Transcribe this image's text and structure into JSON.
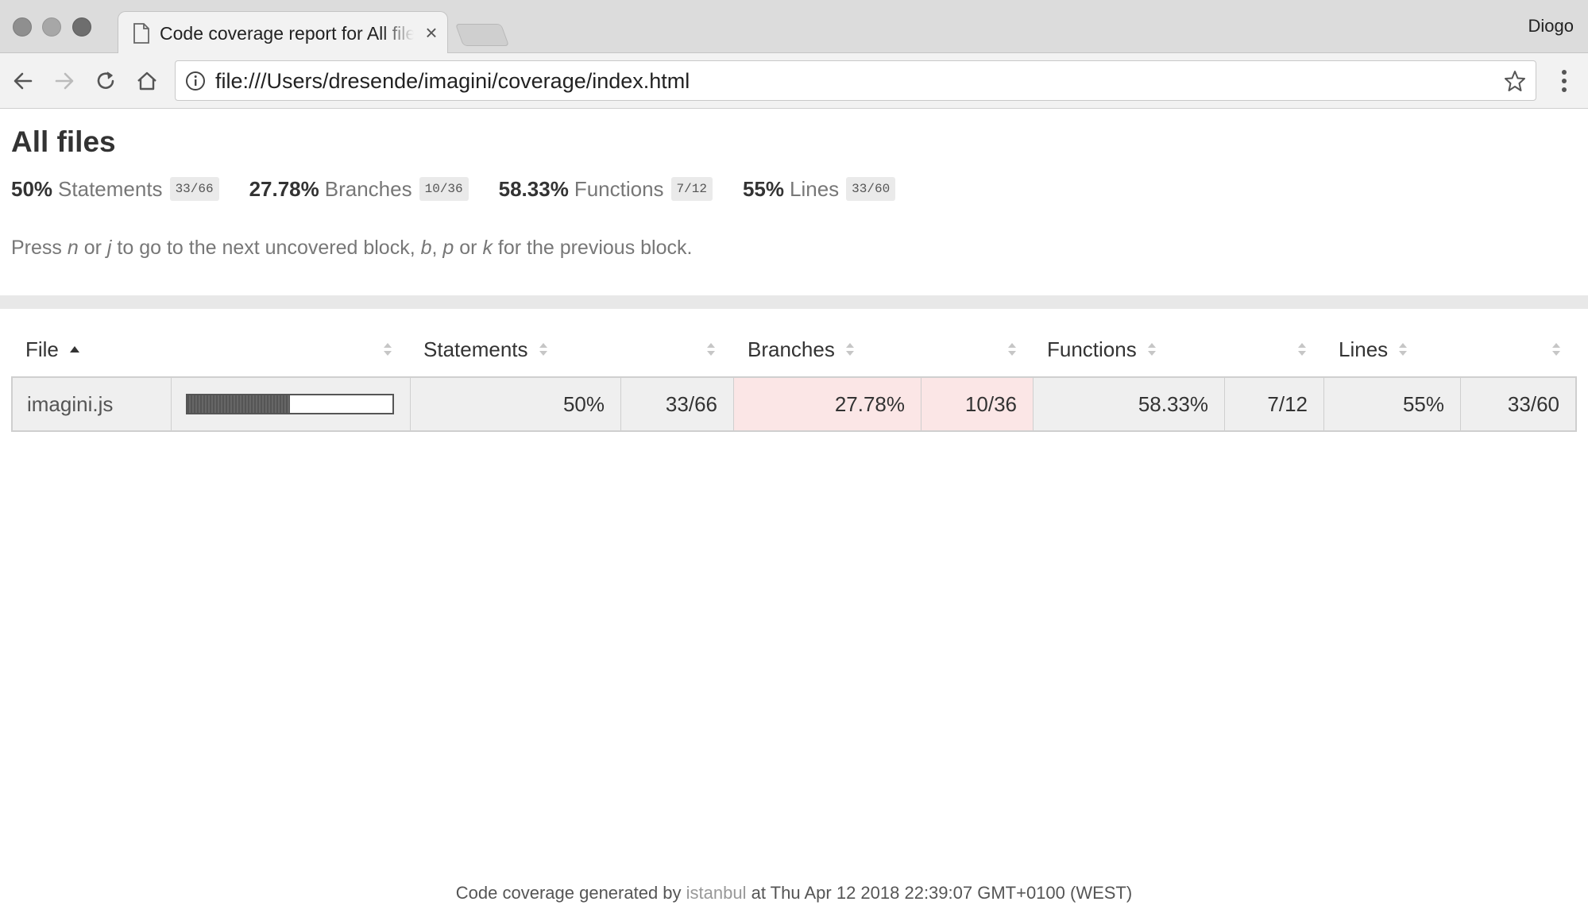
{
  "browser": {
    "tab_title": "Code coverage report for All files",
    "profile_name": "Diogo",
    "url": "file:///Users/dresende/imagini/coverage/index.html"
  },
  "page": {
    "title": "All files",
    "summary": [
      {
        "pct": "50%",
        "label": "Statements",
        "fraction": "33/66"
      },
      {
        "pct": "27.78%",
        "label": "Branches",
        "fraction": "10/36"
      },
      {
        "pct": "58.33%",
        "label": "Functions",
        "fraction": "7/12"
      },
      {
        "pct": "55%",
        "label": "Lines",
        "fraction": "33/60"
      }
    ],
    "hint": {
      "press": "Press ",
      "n": "n",
      "or1": " or ",
      "j": "j",
      "mid": " to go to the next uncovered block, ",
      "b": "b",
      "comma": ", ",
      "p": "p",
      "or2": " or ",
      "k": "k",
      "end": " for the previous block."
    }
  },
  "table": {
    "headers": {
      "file": "File",
      "statements": "Statements",
      "branches": "Branches",
      "functions": "Functions",
      "lines": "Lines"
    },
    "rows": [
      {
        "file": "imagini.js",
        "coverage_fraction": 0.5,
        "statements_pct": "50%",
        "statements_frac": "33/66",
        "branches_pct": "27.78%",
        "branches_frac": "10/36",
        "functions_pct": "58.33%",
        "functions_frac": "7/12",
        "lines_pct": "55%",
        "lines_frac": "33/60"
      }
    ]
  },
  "footer": {
    "prefix": "Code coverage generated by ",
    "link": "istanbul",
    "suffix": " at Thu Apr 12 2018 22:39:07 GMT+0100 (WEST)"
  },
  "colors": {
    "low_coverage_bg": "#fbe6e6",
    "neutral_cell_bg": "#efefef"
  }
}
